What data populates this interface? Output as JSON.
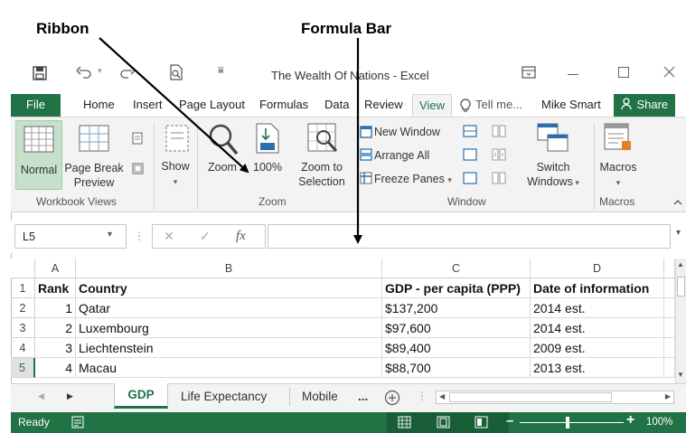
{
  "annotations": {
    "ribbon": "Ribbon",
    "formula_bar": "Formula Bar"
  },
  "window": {
    "title": "The Wealth Of Nations - Excel",
    "user": "Mike Smart"
  },
  "tabs": {
    "file": "File",
    "home": "Home",
    "insert": "Insert",
    "page_layout": "Page Layout",
    "formulas": "Formulas",
    "data": "Data",
    "review": "Review",
    "view": "View",
    "tell_me": "Tell me...",
    "share": "Share"
  },
  "ribbon": {
    "normal": "Normal",
    "page_break_line1": "Page Break",
    "page_break_line2": "Preview",
    "show": "Show",
    "zoom": "Zoom",
    "zoom100": "100%",
    "zoom_sel_line1": "Zoom to",
    "zoom_sel_line2": "Selection",
    "new_window": "New Window",
    "arrange_all": "Arrange All",
    "freeze_panes": "Freeze Panes",
    "switch_line1": "Switch",
    "switch_line2": "Windows",
    "macros": "Macros",
    "groups": {
      "workbook_views": "Workbook Views",
      "zoom": "Zoom",
      "window": "Window",
      "macros": "Macros"
    }
  },
  "formula_bar": {
    "name_box": "L5",
    "fx": "fx",
    "value": ""
  },
  "columns": [
    "A",
    "B",
    "C",
    "D"
  ],
  "rows": [
    "1",
    "2",
    "3",
    "4",
    "5"
  ],
  "table": {
    "headers": [
      "Rank",
      "Country",
      "GDP - per capita (PPP)",
      "Date of information"
    ],
    "data": [
      [
        "1",
        "Qatar",
        "$137,200",
        "2014 est."
      ],
      [
        "2",
        "Luxembourg",
        "$97,600",
        "2014 est."
      ],
      [
        "3",
        "Liechtenstein",
        "$89,400",
        "2009 est."
      ],
      [
        "4",
        "Macau",
        "$88,700",
        "2013 est."
      ]
    ]
  },
  "sheets": {
    "active": "GDP",
    "second": "Life Expectancy",
    "third": "Mobile",
    "more": "..."
  },
  "status": {
    "ready": "Ready",
    "zoom": "100%"
  },
  "colors": {
    "excel_green": "#217346",
    "active_tab_text": "#217346"
  }
}
